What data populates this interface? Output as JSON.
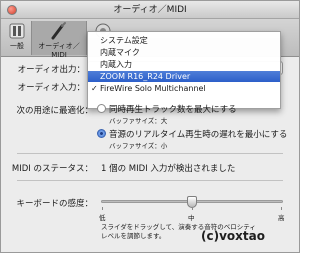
{
  "window": {
    "title": "オーディオ／MIDI"
  },
  "toolbar": {
    "general_label": "一般",
    "audio_midi_label": "オーディオ／MIDI"
  },
  "audio_output": {
    "label": "オーディオ出力：",
    "value": ""
  },
  "audio_input": {
    "label": "オーディオ入力：",
    "value": "FireWire Solo Multichannel"
  },
  "menu": {
    "items": [
      {
        "label": "システム設定",
        "checked": false,
        "selected": false
      },
      {
        "label": "内蔵マイク",
        "checked": false,
        "selected": false
      },
      {
        "label": "内蔵入力",
        "checked": false,
        "selected": false
      },
      {
        "label": "ZOOM R16_R24 Driver",
        "checked": false,
        "selected": true
      },
      {
        "label": "FireWire Solo Multichannel",
        "checked": true,
        "selected": false
      }
    ]
  },
  "optimize": {
    "label": "次の用途に最適化：",
    "option1_line1": "同時再生トラック数を最大にする",
    "option1_line2": "バッファサイズ：大",
    "option2_line1": "音源のリアルタイム再生時の遅れを最小にする",
    "option2_line2": "バッファサイズ：小",
    "selected_option": 2
  },
  "midi_status": {
    "label": "MIDI のステータス：",
    "value": "1 個の MIDI 入力が検出されました"
  },
  "keyboard_sensitivity": {
    "label": "キーボードの感度：",
    "low_label": "低",
    "mid_label": "中",
    "high_label": "高",
    "level": 0.5,
    "help_line1": "スライダをドラッグして、演奏する音符のベロシティ",
    "help_line2": "レベルを調節します。"
  },
  "watermark": "(c)voxtao",
  "colors": {
    "selection": "#2c5fc9",
    "radio_on": "#3e74d4"
  }
}
